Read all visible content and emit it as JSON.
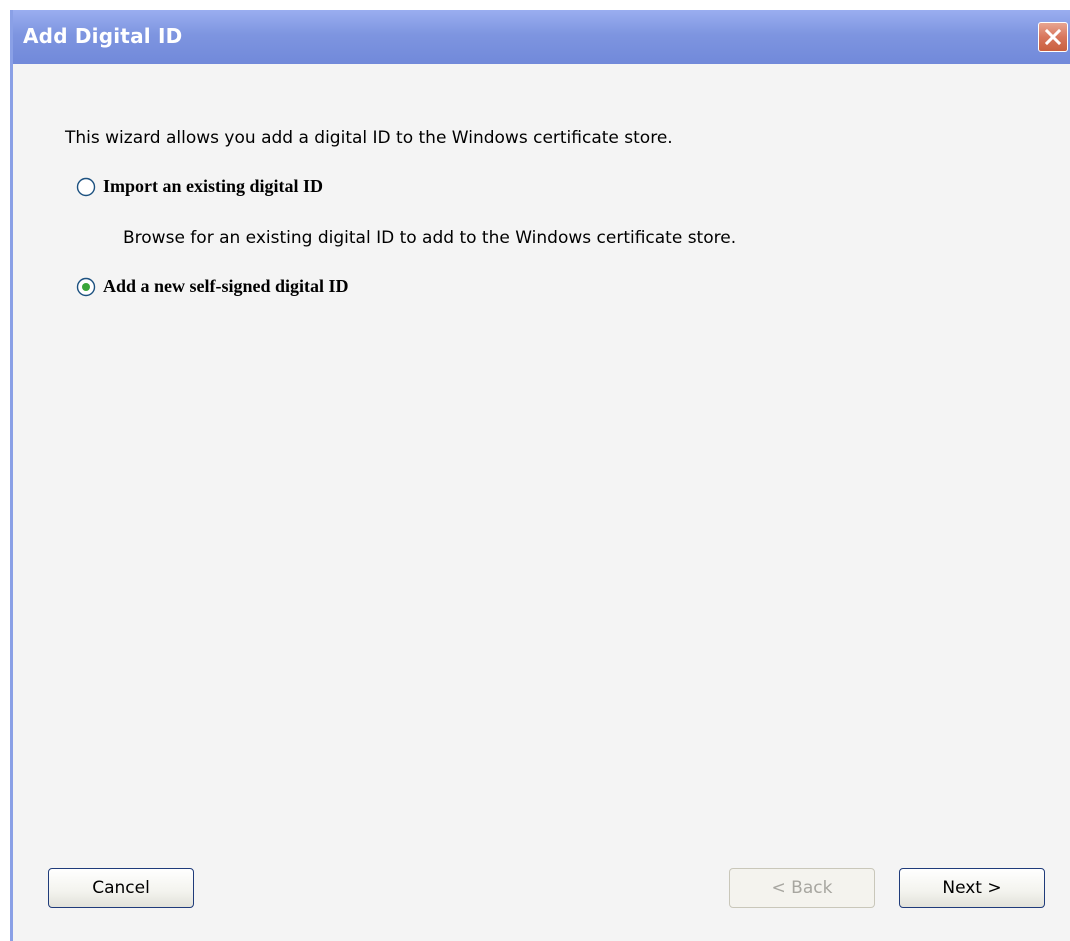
{
  "window": {
    "title": "Add Digital ID",
    "accent_color": "#7e95e0",
    "close_icon": "close-icon"
  },
  "content": {
    "intro": "This wizard allows you add a digital ID to the Windows certificate store.",
    "options": [
      {
        "label": "Import an existing digital ID",
        "description": "Browse for an existing digital ID to add to the Windows certificate store.",
        "selected": false
      },
      {
        "label": "Add a new self-signed digital ID",
        "selected": true
      }
    ]
  },
  "buttons": {
    "cancel": "Cancel",
    "back": "< Back",
    "back_enabled": false,
    "next": "Next >"
  }
}
